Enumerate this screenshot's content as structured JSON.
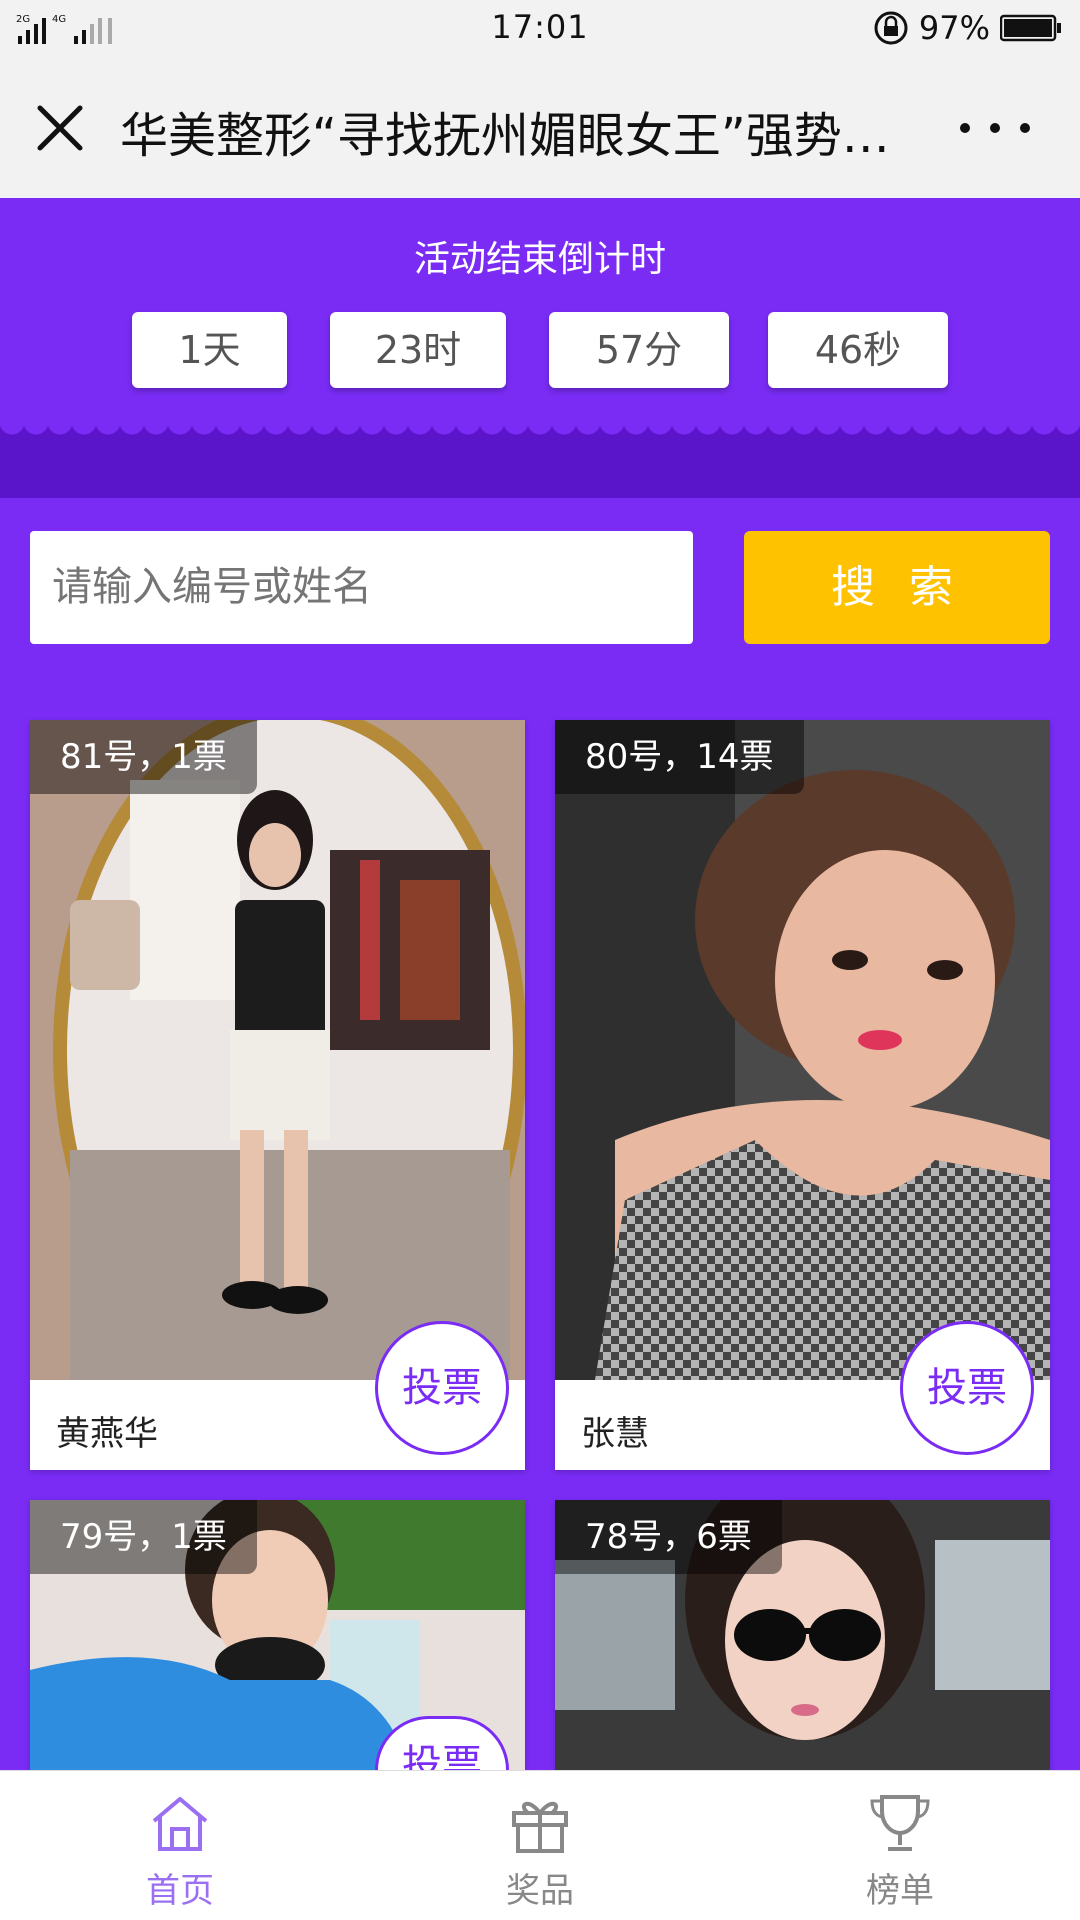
{
  "status_bar": {
    "network": "2G 4G 4G",
    "time": "17:01",
    "battery": "97%"
  },
  "header": {
    "title": "华美整形“寻找抚州媚眼女王”强势…"
  },
  "countdown": {
    "title": "活动结束倒计时",
    "days": "1天",
    "hours": "23时",
    "minutes": "57分",
    "seconds": "46秒"
  },
  "search": {
    "placeholder": "请输入编号或姓名",
    "button_label": "搜 索"
  },
  "contestants": [
    {
      "badge": "81号，1票",
      "name": "黄燕华",
      "vote_label": "投票"
    },
    {
      "badge": "80号，14票",
      "name": "张慧",
      "vote_label": "投票"
    },
    {
      "badge": "79号，1票",
      "name": "",
      "vote_label": "投票"
    },
    {
      "badge": "78号，6票",
      "name": "",
      "vote_label": ""
    }
  ],
  "nav": {
    "items": [
      {
        "label": "首页",
        "icon": "home-icon",
        "active": true
      },
      {
        "label": "奖品",
        "icon": "gift-icon",
        "active": false
      },
      {
        "label": "榜单",
        "icon": "trophy-icon",
        "active": false
      }
    ]
  },
  "colors": {
    "primary": "#7a2cf5",
    "accent": "#ffc200",
    "nav_active": "#9b6ff2",
    "nav_inactive": "#888888"
  }
}
